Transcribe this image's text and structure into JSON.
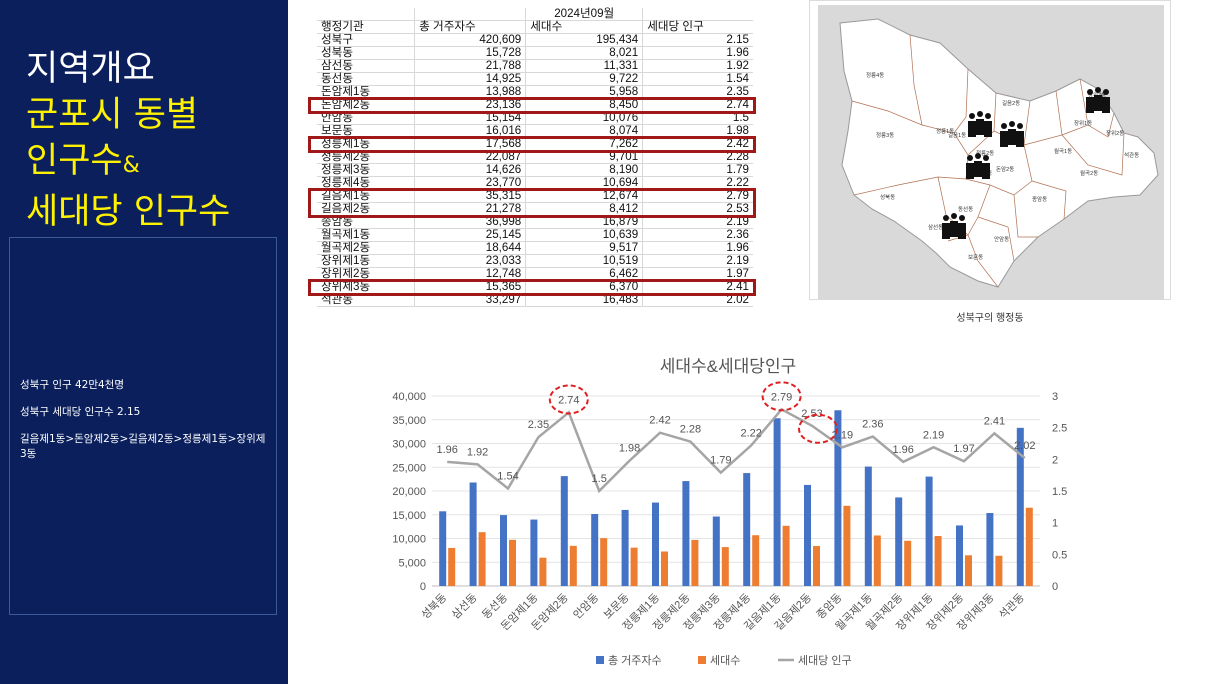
{
  "slide": {
    "title_line1": "지역개요",
    "title_line2": "군포시 동별",
    "title_line3a": "인구수",
    "title_line3b": "&",
    "title_line4": "세대당 인구수",
    "summary": [
      "성북구 인구 42만4천명",
      "성북구 세대당 인구수 2.15",
      "길음제1동>돈암제2동>길음제2동>정릉제1동>장위제3동"
    ]
  },
  "table": {
    "period": "2024년09월",
    "headers": [
      "행정기관",
      "총 거주자수",
      "세대수",
      "세대당 인구"
    ],
    "rows": [
      [
        "성북구",
        "420,609",
        "195,434",
        "2.15"
      ],
      [
        "성북동",
        "15,728",
        "8,021",
        "1.96"
      ],
      [
        "삼선동",
        "21,788",
        "11,331",
        "1.92"
      ],
      [
        "동선동",
        "14,925",
        "9,722",
        "1.54"
      ],
      [
        "돈암제1동",
        "13,988",
        "5,958",
        "2.35"
      ],
      [
        "돈암제2동",
        "23,136",
        "8,450",
        "2.74"
      ],
      [
        "안암동",
        "15,154",
        "10,076",
        "1.5"
      ],
      [
        "보문동",
        "16,016",
        "8,074",
        "1.98"
      ],
      [
        "정릉제1동",
        "17,568",
        "7,262",
        "2.42"
      ],
      [
        "정릉제2동",
        "22,087",
        "9,701",
        "2.28"
      ],
      [
        "정릉제3동",
        "14,626",
        "8,190",
        "1.79"
      ],
      [
        "정릉제4동",
        "23,770",
        "10,694",
        "2.22"
      ],
      [
        "길음제1동",
        "35,315",
        "12,674",
        "2.79"
      ],
      [
        "길음제2동",
        "21,278",
        "8,412",
        "2.53"
      ],
      [
        "종암동",
        "36,998",
        "16,879",
        "2.19"
      ],
      [
        "월곡제1동",
        "25,145",
        "10,639",
        "2.36"
      ],
      [
        "월곡제2동",
        "18,644",
        "9,517",
        "1.96"
      ],
      [
        "장위제1동",
        "23,033",
        "10,519",
        "2.19"
      ],
      [
        "장위제2동",
        "12,748",
        "6,462",
        "1.97"
      ],
      [
        "장위제3동",
        "15,365",
        "6,370",
        "2.41"
      ],
      [
        "석관동",
        "33,297",
        "16,483",
        "2.02"
      ]
    ],
    "highlighted": [
      "돈암제2동",
      "정릉제1동",
      "길음제1동",
      "길음제2동",
      "장위제3동"
    ]
  },
  "map": {
    "caption": "성북구의 행정동",
    "labels": [
      "정릉4동",
      "정릉3동",
      "정릉1동",
      "정릉2동",
      "길음1동",
      "길음2동",
      "돈암1동",
      "돈암2동",
      "성북동",
      "삼선동",
      "동선동",
      "안암동",
      "보문동",
      "종암동",
      "월곡1동",
      "월곡2동",
      "장위1동",
      "장위2동",
      "장위3동",
      "석관동"
    ],
    "bg_color": "#d9d9d9",
    "region_color": "#ffffff",
    "border_color": "#b07050",
    "icon_color": "#111111"
  },
  "chart_data": {
    "type": "bar",
    "title": "세대수&세대당인구",
    "categories": [
      "성북동",
      "삼선동",
      "동선동",
      "돈암제1동",
      "돈암제2동",
      "안암동",
      "보문동",
      "정릉제1동",
      "정릉제2동",
      "정릉제3동",
      "정릉제4동",
      "길음제1동",
      "길음제2동",
      "종암동",
      "월곡제1동",
      "월곡제2동",
      "장위제1동",
      "장위제2동",
      "장위제3동",
      "석관동"
    ],
    "series": [
      {
        "name": "총 거주자수",
        "type": "bar",
        "axis": "left",
        "color": "#4472c4",
        "values": [
          15728,
          21788,
          14925,
          13988,
          23136,
          15154,
          16016,
          17568,
          22087,
          14626,
          23770,
          35315,
          21278,
          36998,
          25145,
          18644,
          23033,
          12748,
          15365,
          33297
        ]
      },
      {
        "name": "세대수",
        "type": "bar",
        "axis": "left",
        "color": "#ed7d31",
        "values": [
          8021,
          11331,
          9722,
          5958,
          8450,
          10076,
          8074,
          7262,
          9701,
          8190,
          10694,
          12674,
          8412,
          16879,
          10639,
          9517,
          10519,
          6462,
          6370,
          16483
        ]
      },
      {
        "name": "세대당 인구",
        "type": "line",
        "axis": "right",
        "color": "#a5a5a5",
        "values": [
          1.96,
          1.92,
          1.54,
          2.35,
          2.74,
          1.5,
          1.98,
          2.42,
          2.28,
          1.79,
          2.22,
          2.79,
          2.53,
          2.19,
          2.36,
          1.96,
          2.19,
          1.97,
          2.41,
          2.02
        ]
      }
    ],
    "y_left": {
      "min": 0,
      "max": 40000,
      "ticks": [
        "0",
        "5,000",
        "10,000",
        "15,000",
        "20,000",
        "25,000",
        "30,000",
        "35,000",
        "40,000"
      ]
    },
    "y_right": {
      "min": 0,
      "max": 3,
      "ticks": [
        "0",
        "0.5",
        "1",
        "1.5",
        "2",
        "2.5",
        "3"
      ]
    },
    "circled": [
      "돈암제2동",
      "길음제1동",
      "길음제2동"
    ],
    "circle_color": "#e02020",
    "grid": true,
    "legend": "bottom"
  }
}
